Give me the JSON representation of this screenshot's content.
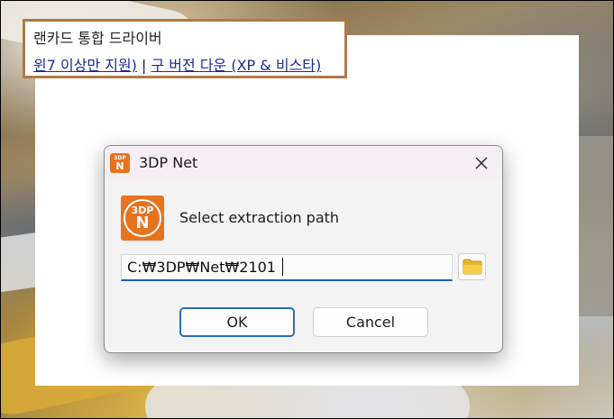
{
  "background_page": {
    "title_fragment": "랜카드 통합 드라이버",
    "link_primary": "윈7 이상만 지원)",
    "separator": "|",
    "link_secondary": "구 버전 다운 (XP & 비스타)"
  },
  "dialog": {
    "title": "3DP Net",
    "app_icon": {
      "top": "3DP",
      "bottom": "N"
    },
    "prompt": "Select extraction path",
    "path_value": "C:₩3DP₩Net₩2101",
    "ok_label": "OK",
    "cancel_label": "Cancel"
  },
  "colors": {
    "accent": "#2a6dc0",
    "brand_orange": "#e8731e",
    "note_border": "#b07a45",
    "link": "#1f2a8c"
  },
  "icons": {
    "close": "close-icon",
    "browse": "folder-icon",
    "app": "3dp-net-icon"
  }
}
